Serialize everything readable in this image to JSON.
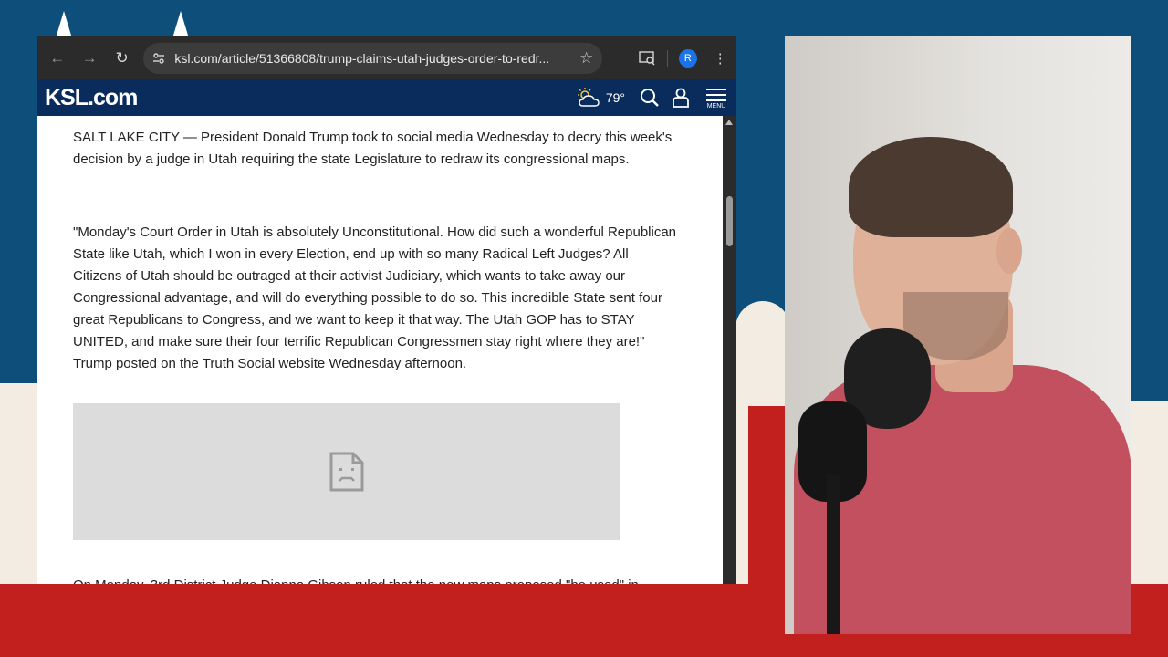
{
  "browser": {
    "url": "ksl.com/article/51366808/trump-claims-utah-judges-order-to-redr...",
    "profile_initial": "R"
  },
  "site": {
    "logo": "KSL.com",
    "temperature": "79°",
    "menu_label": "MENU"
  },
  "article": {
    "paragraphs": [
      "SALT LAKE CITY — President Donald Trump took to social media Wednesday to decry this week's decision by a judge in Utah requiring the state Legislature to redraw its congressional maps.",
      "\"Monday's Court Order in Utah is absolutely Unconstitutional. How did such a wonderful Republican State like Utah, which I won in every Election, end up with so many Radical Left Judges? All Citizens of Utah should be outraged at their activist Judiciary, which wants to take away our Congressional advantage, and will do everything possible to do so. This incredible State sent four great Republicans to Congress, and we want to keep it that way. The Utah GOP has to STAY UNITED, and make sure their four terrific Republican Congressmen stay right where they are!\" Trump posted on the Truth Social website Wednesday afternoon.",
      "On Monday, 3rd District Judge Dianna Gibson ruled that the new maps proposed \"be used\" in"
    ]
  },
  "colors": {
    "backdrop_blue": "#0d4f7a",
    "backdrop_red": "#c2201e",
    "site_header": "#092c5c"
  }
}
